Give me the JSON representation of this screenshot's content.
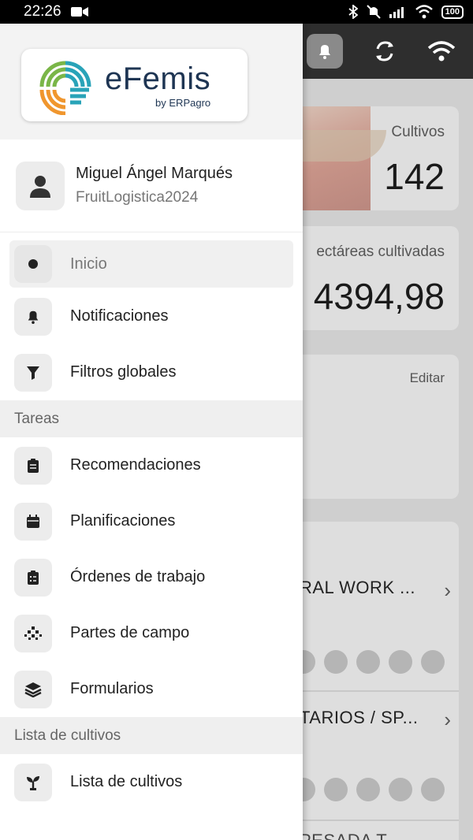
{
  "status_bar": {
    "time": "22:26",
    "battery": "100"
  },
  "drawer": {
    "logo": {
      "name": "eFemis",
      "sub": "by ERPagro"
    },
    "user": {
      "name": "Miguel Ángel Marqués",
      "org": "FruitLogistica2024"
    },
    "menu_top": [
      {
        "label": "Inicio",
        "icon": "dot-icon",
        "active": true
      },
      {
        "label": "Notificaciones",
        "icon": "bell-icon"
      },
      {
        "label": "Filtros globales",
        "icon": "filter-icon"
      }
    ],
    "section_tareas": "Tareas",
    "menu_tareas": [
      {
        "label": "Recomendaciones",
        "icon": "clipboard-icon"
      },
      {
        "label": "Planificaciones",
        "icon": "calendar-icon"
      },
      {
        "label": "Órdenes de trabajo",
        "icon": "checklist-icon"
      },
      {
        "label": "Partes de campo",
        "icon": "grid-dots-icon"
      },
      {
        "label": "Formularios",
        "icon": "layers-icon"
      }
    ],
    "section_cultivos": "Lista de cultivos",
    "menu_cultivos": [
      {
        "label": "Lista de cultivos",
        "icon": "sprout-icon"
      }
    ]
  },
  "background": {
    "card1": {
      "label": "Cultivos",
      "value": "142"
    },
    "card2": {
      "label": "ectáreas cultivadas",
      "value": "4394,98"
    },
    "card3": {
      "edit": "Editar"
    },
    "rows": [
      {
        "title": "RAL WORK ..."
      },
      {
        "title": "TARIOS / SP..."
      },
      {
        "title": "PESADA T..."
      }
    ]
  }
}
